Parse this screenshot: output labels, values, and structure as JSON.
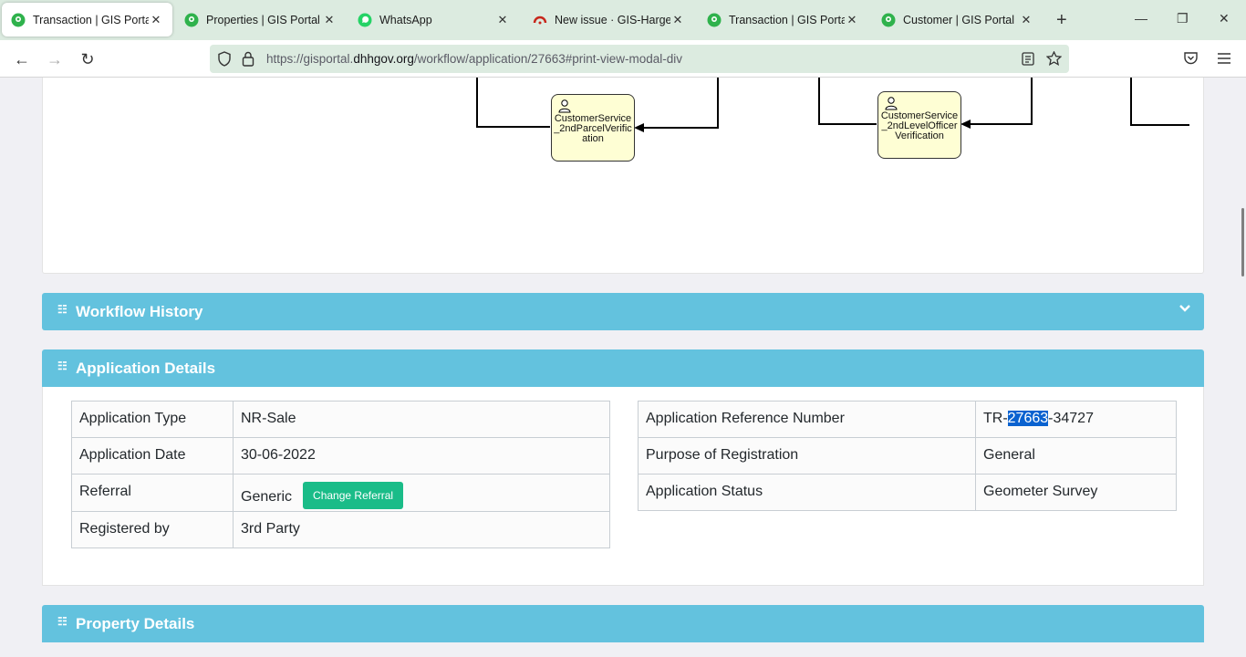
{
  "browser": {
    "tabs": [
      {
        "title": "Transaction | GIS Portal",
        "icon": "gis-portal-icon",
        "active": true
      },
      {
        "title": "Properties | GIS Portal",
        "icon": "gis-portal-icon",
        "active": false
      },
      {
        "title": "WhatsApp",
        "icon": "whatsapp-icon",
        "active": false
      },
      {
        "title": "New issue · GIS-Hargesia",
        "icon": "gitlab-icon",
        "active": false
      },
      {
        "title": "Transaction | GIS Portal",
        "icon": "gis-portal-icon",
        "active": false
      },
      {
        "title": "Customer | GIS Portal",
        "icon": "gis-portal-icon",
        "active": false
      }
    ],
    "url_prefix": "https://gisportal.",
    "url_domain": "dhhgov.org",
    "url_path": "/workflow/application/27663#print-view-modal-div",
    "colors": {
      "tabstrip": "#dcebe0",
      "accent": "#63c2de",
      "button_green": "#1abc88"
    }
  },
  "diagram": {
    "nodes": [
      {
        "label": "CustomerService_2ndParcelVerification"
      },
      {
        "label": "CustomerService_2ndLevelOfficerVerification"
      }
    ]
  },
  "panels": {
    "workflow_history": {
      "title": "Workflow History"
    },
    "application_details": {
      "title": "Application Details"
    },
    "property_details": {
      "title": "Property Details"
    }
  },
  "application": {
    "left": [
      {
        "label": "Application Type",
        "value": "NR-Sale"
      },
      {
        "label": "Application Date",
        "value": "30-06-2022"
      },
      {
        "label": "Referral",
        "value": "Generic"
      },
      {
        "label": "Registered by",
        "value": "3rd Party"
      }
    ],
    "change_referral_label": "Change Referral",
    "right": [
      {
        "label": "Application Reference Number",
        "value_prefix": "TR-",
        "value_highlight": "27663",
        "value_suffix": "-34727"
      },
      {
        "label": "Purpose of Registration",
        "value": "General"
      },
      {
        "label": "Application Status",
        "value": "Geometer Survey"
      }
    ]
  }
}
